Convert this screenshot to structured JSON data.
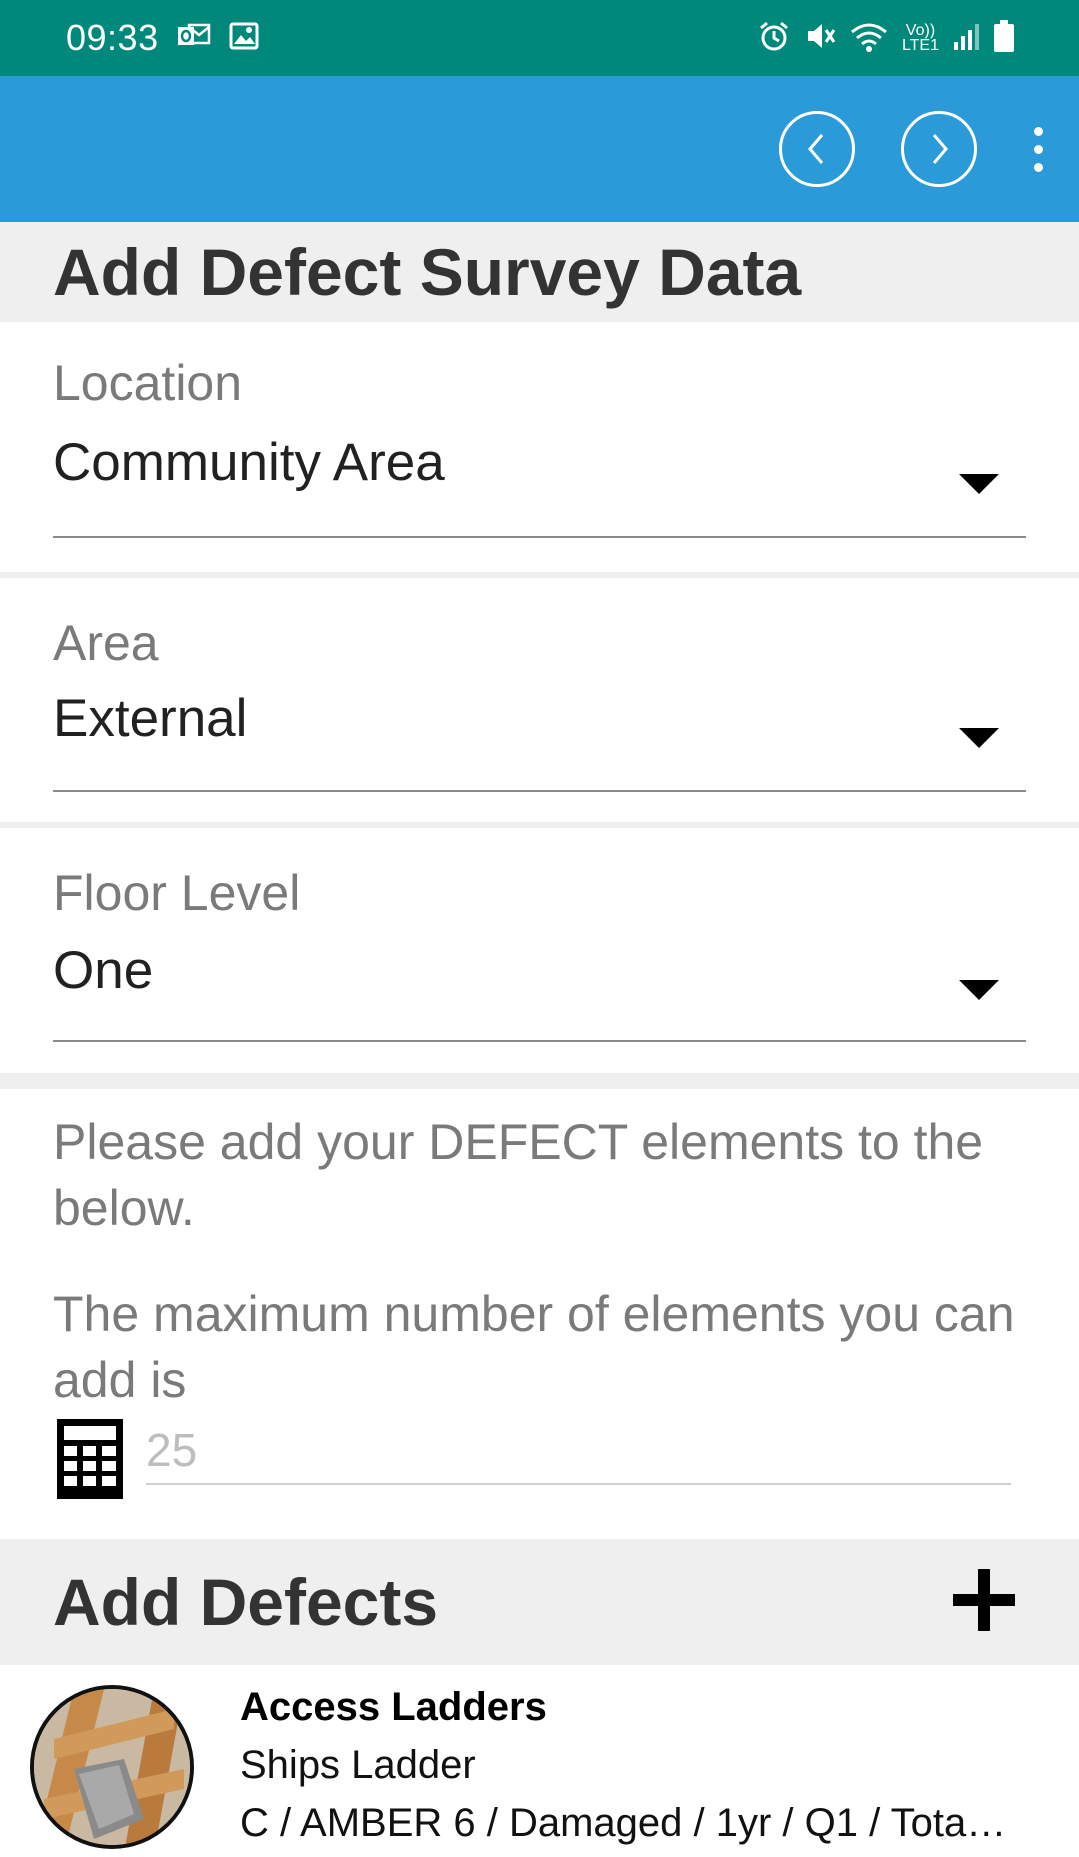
{
  "status_bar": {
    "time": "09:33",
    "left_icons": [
      "outlook-notification-icon",
      "gallery-notification-icon"
    ],
    "right_icons": [
      "alarm-icon",
      "mute-icon",
      "wifi-icon",
      "volte-icon",
      "signal-icon",
      "battery-icon"
    ],
    "volte_label": "Vo))",
    "lte_label": "LTE1"
  },
  "app_bar": {
    "color": "#2a9bd8",
    "prev_icon": "chevron-left-icon",
    "next_icon": "chevron-right-icon",
    "menu_icon": "more-vert-icon"
  },
  "page": {
    "title": "Add Defect Survey Data"
  },
  "fields": [
    {
      "label": "Location",
      "value": "Community Area"
    },
    {
      "label": "Area",
      "value": "External"
    },
    {
      "label": "Floor Level",
      "value": "One"
    }
  ],
  "info": {
    "instruction": "Please add your DEFECT elements to the below.",
    "max_label": "The maximum number of elements you can add is",
    "max_value": "25"
  },
  "defects_section": {
    "title": "Add Defects",
    "add_icon": "plus-icon",
    "items": [
      {
        "title": "Access Ladders",
        "subtitle": "Ships Ladder",
        "detail": "C / AMBER 6 / Damaged / 1yr / Q1 / Tota…"
      }
    ]
  },
  "colors": {
    "status_bar": "#00897b",
    "app_bar": "#2a9bd8",
    "section_bg": "#efefef"
  }
}
